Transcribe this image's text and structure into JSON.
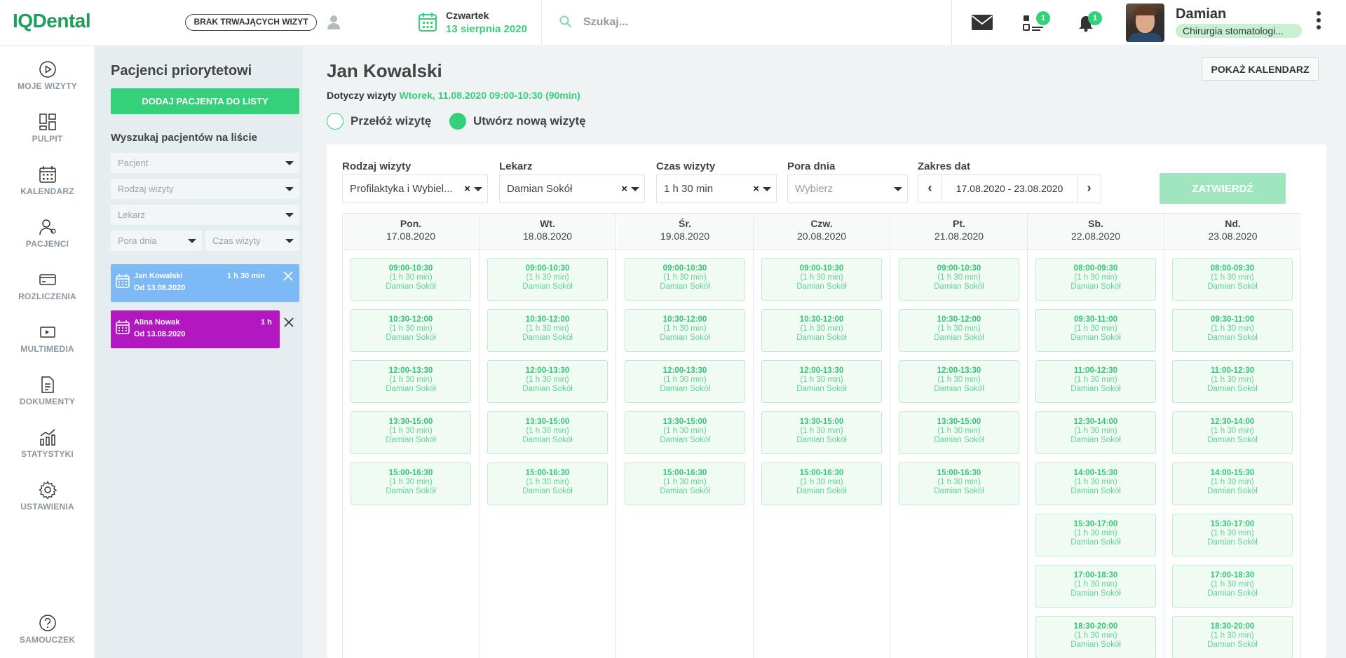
{
  "app": {
    "logo": "IQDental",
    "visit_status": "BRAK TRWAJĄCYCH WIZYT",
    "date_day": "Czwartek",
    "date_full": "13 sierpnia 2020",
    "search_placeholder": "Szukaj...",
    "tasks_badge": "1",
    "notifications_badge": "1",
    "user_name": "Damian",
    "user_role": "Chirurgia stomatologi..."
  },
  "nav": [
    {
      "label": "MOJE WIZYTY",
      "icon": "play-circle-icon"
    },
    {
      "label": "PULPIT",
      "icon": "dashboard-icon"
    },
    {
      "label": "KALENDARZ",
      "icon": "calendar-icon"
    },
    {
      "label": "PACJENCI",
      "icon": "patients-icon"
    },
    {
      "label": "ROZLICZENIA",
      "icon": "credit-card-icon"
    },
    {
      "label": "MULTIMEDIA",
      "icon": "multimedia-icon"
    },
    {
      "label": "DOKUMENTY",
      "icon": "document-icon"
    },
    {
      "label": "STATYSTYKI",
      "icon": "chart-icon"
    },
    {
      "label": "USTAWIENIA",
      "icon": "gear-icon"
    },
    {
      "label": "SAMOUCZEK",
      "icon": "help-icon"
    }
  ],
  "priority_panel": {
    "title": "Pacjenci priorytetowi",
    "add_button": "DODAJ PACJENTA DO LISTY",
    "search_title": "Wyszukaj pacjentów na liście",
    "filters": {
      "patient": "Pacjent",
      "visit_type": "Rodzaj wizyty",
      "doctor": "Lekarz",
      "time_of_day": "Pora dnia",
      "visit_time": "Czas wizyty"
    },
    "patients": [
      {
        "name": "Jan Kowalski",
        "duration": "1 h 30 min",
        "since": "Od 13.08.2020",
        "color": "#7db9f5"
      },
      {
        "name": "Alina Nowak",
        "duration": "1 h",
        "since": "Od 13.08.2020",
        "color": "#b217c0"
      }
    ]
  },
  "main": {
    "patient_name": "Jan Kowalski",
    "show_calendar_button": "POKAŻ KALENDARZ",
    "concerns_label": "Dotyczy wizyty",
    "concerns_value": "Wtorek, 11.08.2020 09:00-10:30 (90min)",
    "radio_reschedule": "Przełóż wizytę",
    "radio_new": "Utwórz nową wizytę",
    "selected_option": "new",
    "filters": {
      "visit_type_label": "Rodzaj wizyty",
      "visit_type_value": "Profilaktyka i Wybiel...",
      "doctor_label": "Lekarz",
      "doctor_value": "Damian Sokół",
      "duration_label": "Czas wizyty",
      "duration_value": "1 h 30 min",
      "time_of_day_label": "Pora dnia",
      "time_of_day_placeholder": "Wybierz",
      "date_range_label": "Zakres dat",
      "date_range_value": "17.08.2020 - 23.08.2020"
    },
    "confirm_button": "ZATWIERDŹ",
    "days": [
      {
        "name": "Pon.",
        "date": "17.08.2020",
        "slots": [
          {
            "time": "09:00-10:30",
            "duration": "(1 h 30 min)",
            "doctor": "Damian Sokół"
          },
          {
            "time": "10:30-12:00",
            "duration": "(1 h 30 min)",
            "doctor": "Damian Sokół"
          },
          {
            "time": "12:00-13:30",
            "duration": "(1 h 30 min)",
            "doctor": "Damian Sokół"
          },
          {
            "time": "13:30-15:00",
            "duration": "(1 h 30 min)",
            "doctor": "Damian Sokół"
          },
          {
            "time": "15:00-16:30",
            "duration": "(1 h 30 min)",
            "doctor": "Damian Sokół"
          }
        ]
      },
      {
        "name": "Wt.",
        "date": "18.08.2020",
        "slots": [
          {
            "time": "09:00-10:30",
            "duration": "(1 h 30 min)",
            "doctor": "Damian Sokół"
          },
          {
            "time": "10:30-12:00",
            "duration": "(1 h 30 min)",
            "doctor": "Damian Sokół"
          },
          {
            "time": "12:00-13:30",
            "duration": "(1 h 30 min)",
            "doctor": "Damian Sokół"
          },
          {
            "time": "13:30-15:00",
            "duration": "(1 h 30 min)",
            "doctor": "Damian Sokół"
          },
          {
            "time": "15:00-16:30",
            "duration": "(1 h 30 min)",
            "doctor": "Damian Sokół"
          }
        ]
      },
      {
        "name": "Śr.",
        "date": "19.08.2020",
        "slots": [
          {
            "time": "09:00-10:30",
            "duration": "(1 h 30 min)",
            "doctor": "Damian Sokół"
          },
          {
            "time": "10:30-12:00",
            "duration": "(1 h 30 min)",
            "doctor": "Damian Sokół"
          },
          {
            "time": "12:00-13:30",
            "duration": "(1 h 30 min)",
            "doctor": "Damian Sokół"
          },
          {
            "time": "13:30-15:00",
            "duration": "(1 h 30 min)",
            "doctor": "Damian Sokół"
          },
          {
            "time": "15:00-16:30",
            "duration": "(1 h 30 min)",
            "doctor": "Damian Sokół"
          }
        ]
      },
      {
        "name": "Czw.",
        "date": "20.08.2020",
        "slots": [
          {
            "time": "09:00-10:30",
            "duration": "(1 h 30 min)",
            "doctor": "Damian Sokół"
          },
          {
            "time": "10:30-12:00",
            "duration": "(1 h 30 min)",
            "doctor": "Damian Sokół"
          },
          {
            "time": "12:00-13:30",
            "duration": "(1 h 30 min)",
            "doctor": "Damian Sokół"
          },
          {
            "time": "13:30-15:00",
            "duration": "(1 h 30 min)",
            "doctor": "Damian Sokół"
          },
          {
            "time": "15:00-16:30",
            "duration": "(1 h 30 min)",
            "doctor": "Damian Sokół"
          }
        ]
      },
      {
        "name": "Pt.",
        "date": "21.08.2020",
        "slots": [
          {
            "time": "09:00-10:30",
            "duration": "(1 h 30 min)",
            "doctor": "Damian Sokół"
          },
          {
            "time": "10:30-12:00",
            "duration": "(1 h 30 min)",
            "doctor": "Damian Sokół"
          },
          {
            "time": "12:00-13:30",
            "duration": "(1 h 30 min)",
            "doctor": "Damian Sokół"
          },
          {
            "time": "13:30-15:00",
            "duration": "(1 h 30 min)",
            "doctor": "Damian Sokół"
          },
          {
            "time": "15:00-16:30",
            "duration": "(1 h 30 min)",
            "doctor": "Damian Sokół"
          }
        ]
      },
      {
        "name": "Sb.",
        "date": "22.08.2020",
        "slots": [
          {
            "time": "08:00-09:30",
            "duration": "(1 h 30 min)",
            "doctor": "Damian Sokół"
          },
          {
            "time": "09:30-11:00",
            "duration": "(1 h 30 min)",
            "doctor": "Damian Sokół"
          },
          {
            "time": "11:00-12:30",
            "duration": "(1 h 30 min)",
            "doctor": "Damian Sokół"
          },
          {
            "time": "12:30-14:00",
            "duration": "(1 h 30 min)",
            "doctor": "Damian Sokół"
          },
          {
            "time": "14:00-15:30",
            "duration": "(1 h 30 min)",
            "doctor": "Damian Sokół"
          },
          {
            "time": "15:30-17:00",
            "duration": "(1 h 30 min)",
            "doctor": "Damian Sokół"
          },
          {
            "time": "17:00-18:30",
            "duration": "(1 h 30 min)",
            "doctor": "Damian Sokół"
          },
          {
            "time": "18:30-20:00",
            "duration": "(1 h 30 min)",
            "doctor": "Damian Sokół"
          }
        ]
      },
      {
        "name": "Nd.",
        "date": "23.08.2020",
        "slots": [
          {
            "time": "08:00-09:30",
            "duration": "(1 h 30 min)",
            "doctor": "Damian Sokół"
          },
          {
            "time": "09:30-11:00",
            "duration": "(1 h 30 min)",
            "doctor": "Damian Sokół"
          },
          {
            "time": "11:00-12:30",
            "duration": "(1 h 30 min)",
            "doctor": "Damian Sokół"
          },
          {
            "time": "12:30-14:00",
            "duration": "(1 h 30 min)",
            "doctor": "Damian Sokół"
          },
          {
            "time": "14:00-15:30",
            "duration": "(1 h 30 min)",
            "doctor": "Damian Sokół"
          },
          {
            "time": "15:30-17:00",
            "duration": "(1 h 30 min)",
            "doctor": "Damian Sokół"
          },
          {
            "time": "17:00-18:30",
            "duration": "(1 h 30 min)",
            "doctor": "Damian Sokół"
          },
          {
            "time": "18:30-20:00",
            "duration": "(1 h 30 min)",
            "doctor": "Damian Sokół"
          }
        ]
      }
    ]
  }
}
